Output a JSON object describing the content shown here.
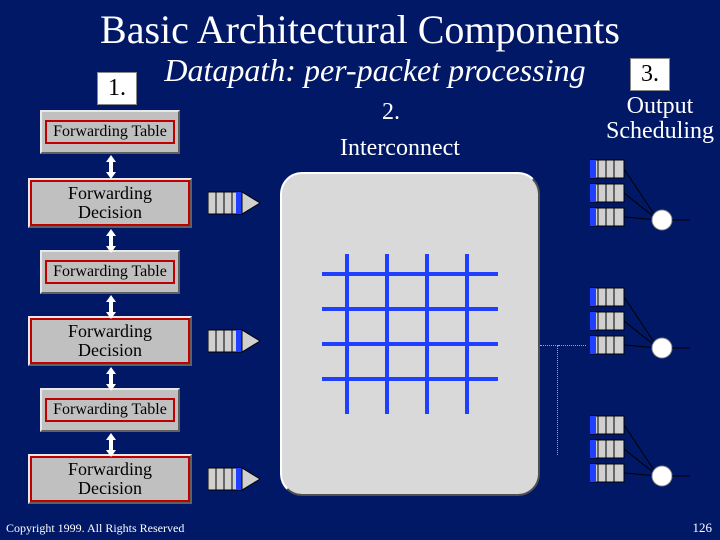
{
  "title": "Basic Architectural Components",
  "subtitle": "Datapath: per-packet processing",
  "numbers": {
    "n1": "1.",
    "n2": "2.",
    "n3": "3."
  },
  "labels": {
    "output_scheduling": "Output Scheduling",
    "interconnect": "Interconnect",
    "forwarding_table": "Forwarding Table",
    "forwarding_decision": "Forwarding Decision"
  },
  "footer": "Copyright 1999. All Rights Reserved",
  "page": "126",
  "colors": {
    "background": "#001866",
    "box_fill": "#c0c0c0",
    "box_border": "#c00000",
    "grid_line": "#2040ff",
    "buffer_fill": "#2040ff",
    "node_fill": "#ffffff"
  }
}
